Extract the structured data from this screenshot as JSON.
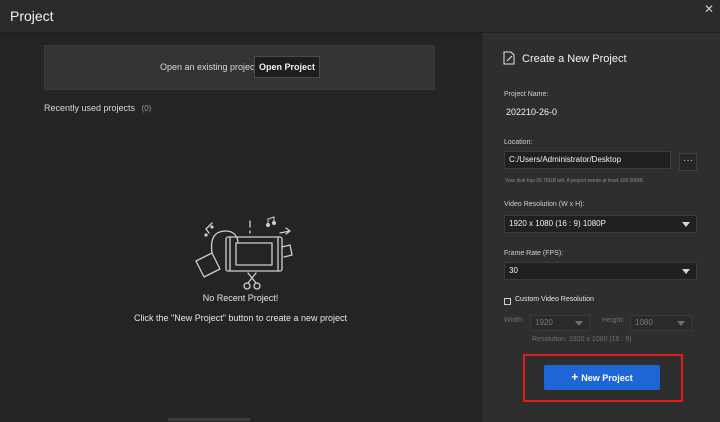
{
  "window": {
    "title": "Project",
    "close_glyph": "✕"
  },
  "left": {
    "open_existing_text": "Open an existing project",
    "open_button": "Open Project",
    "recent_label": "Recently used projects",
    "recent_count": "(0)",
    "empty_title": "No Recent Project!",
    "empty_subtitle": "Click the \"New Project\" button to create a new project",
    "illustration_icon": "film-scissors-illustration-icon"
  },
  "right": {
    "title": "Create a New Project",
    "title_icon": "edit-document-icon",
    "project_name_label": "Project Name:",
    "project_name_value": "202210-26-0",
    "location_label": "Location:",
    "location_value": "C:/Users/Administrator/Desktop",
    "location_more": "···",
    "disk_hint": "Your disk has 26.78GB left. A project needs at least 100.00MB.",
    "resolution_label": "Video Resolution (W x H):",
    "resolution_value": "1920 x 1080   (16 : 9)   1080P",
    "framerate_label": "Frame Rate (FPS):",
    "framerate_value": "30",
    "custom_label": "Custom Video Resolution",
    "width_label": "Width:",
    "width_value": "1920",
    "height_label": "Height:",
    "height_value": "1080",
    "custom_resolution_text": "Resolution: 1920 x 1080   (16 : 9)",
    "new_button": "New Project",
    "new_button_icon": "plus-icon"
  },
  "colors": {
    "accent": "#1e66d6",
    "highlight": "#e11c1c",
    "bg": "#242424"
  }
}
